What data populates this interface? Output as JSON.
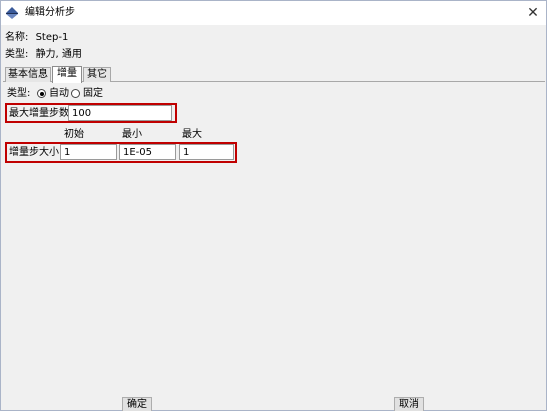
{
  "window": {
    "title": "编辑分析步",
    "close_glyph": "✕"
  },
  "info": {
    "name_label": "名称:",
    "name_value": "Step-1",
    "type_label": "类型:",
    "type_value": "静力, 通用"
  },
  "tabs": [
    {
      "label": "基本信息",
      "active": false
    },
    {
      "label": "增量",
      "active": true
    },
    {
      "label": "其它",
      "active": false
    }
  ],
  "increment": {
    "type_label": "类型:",
    "options": [
      {
        "label": "自动",
        "selected": true
      },
      {
        "label": "固定",
        "selected": false
      }
    ],
    "max_steps_label": "最大增量步数:",
    "max_steps_value": "100",
    "columns": [
      "初始",
      "最小",
      "最大"
    ],
    "size_label": "增量步大小:",
    "initial": "1",
    "minimum": "1E-05",
    "maximum": "1"
  },
  "buttons": {
    "ok": "确定",
    "cancel": "取消"
  },
  "colors": {
    "highlight": "#c00000",
    "icon": "#3a5a9a"
  },
  "icons": {
    "title": "abaqus-step-icon",
    "close": "close-icon"
  }
}
